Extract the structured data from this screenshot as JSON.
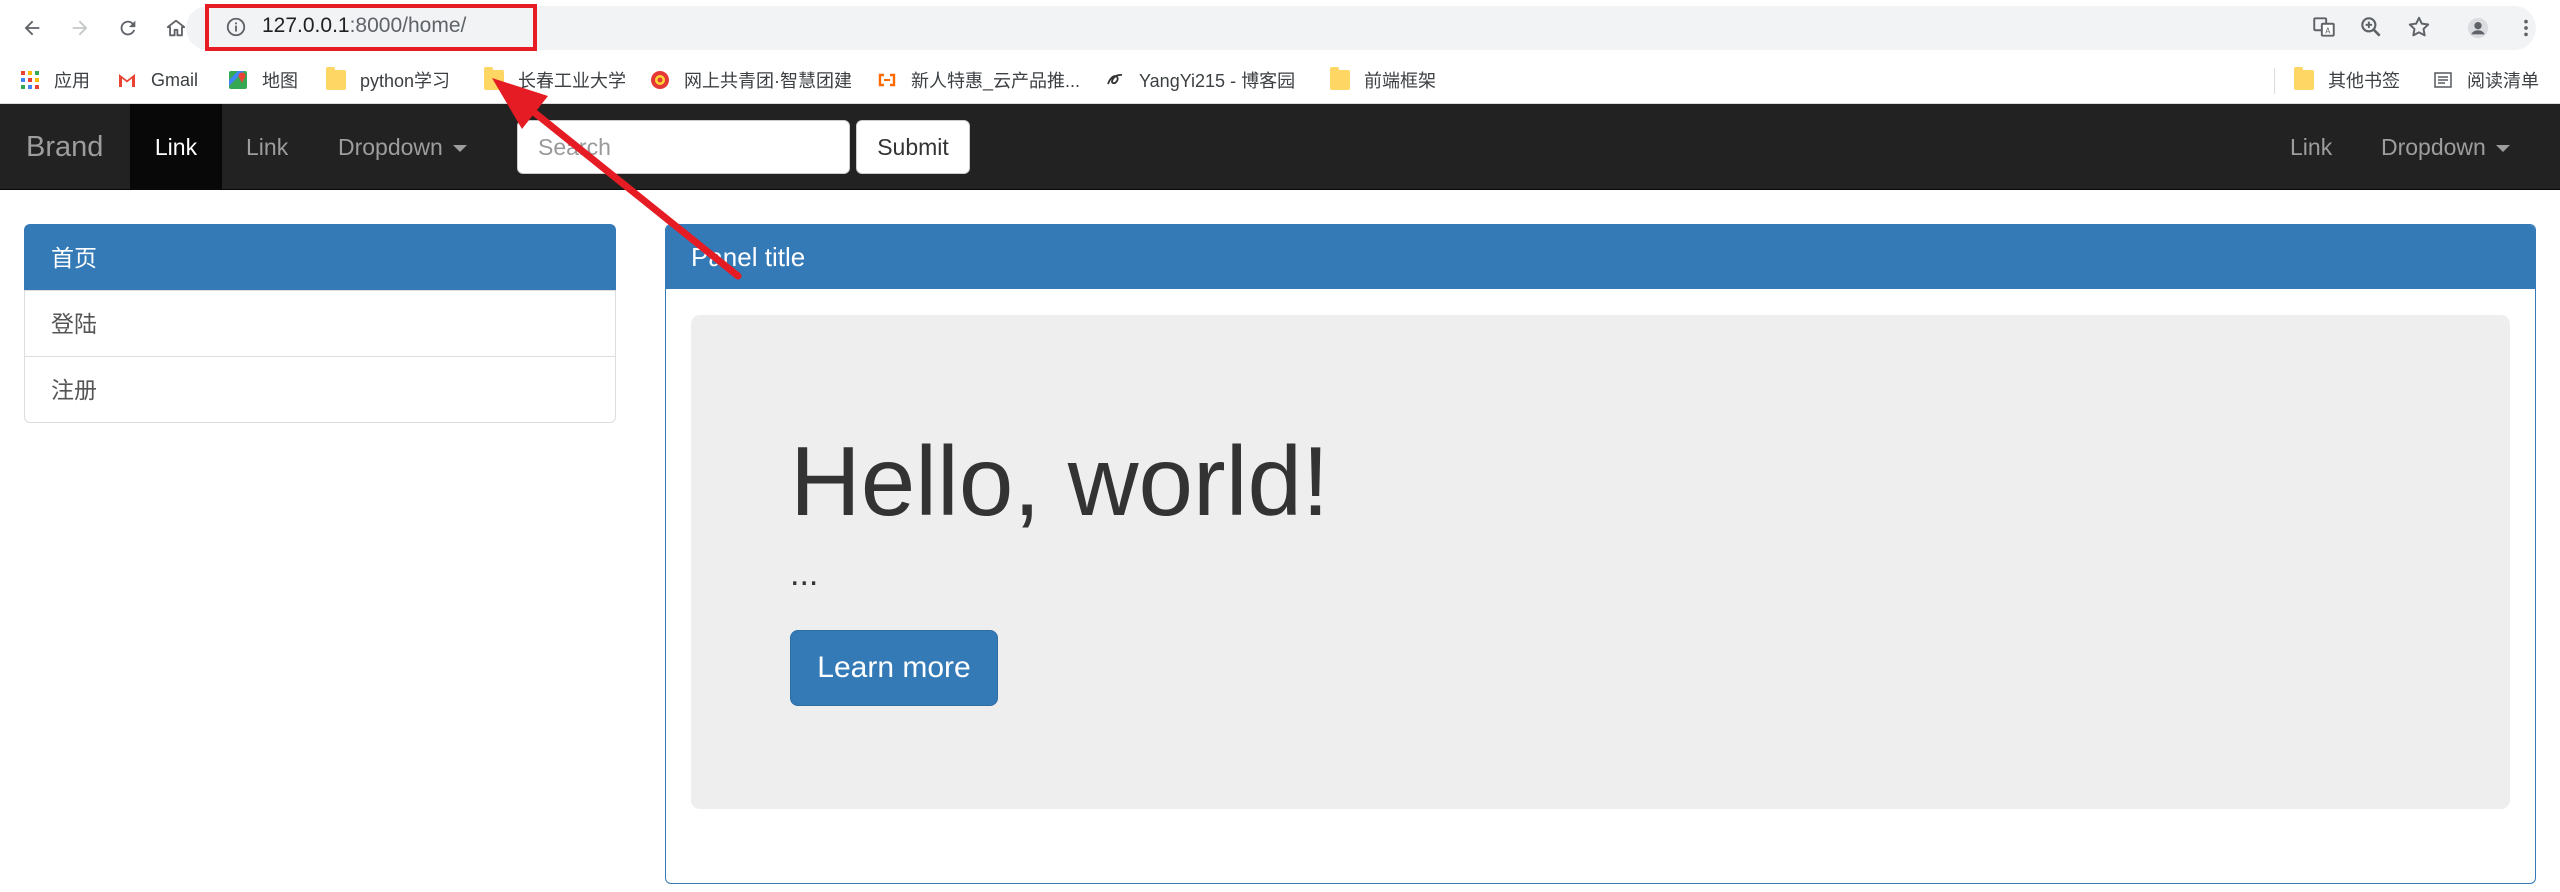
{
  "browser": {
    "url_host": "127.0.0.1",
    "url_rest": ":8000/home/",
    "bookmarks": [
      {
        "label": "应用",
        "icon": "apps-grid-icon"
      },
      {
        "label": "Gmail",
        "icon": "gmail-icon"
      },
      {
        "label": "地图",
        "icon": "maps-icon"
      },
      {
        "label": "python学习",
        "icon": "folder-icon"
      },
      {
        "label": "长春工业大学",
        "icon": "folder-icon"
      },
      {
        "label": "网上共青团·智慧团建",
        "icon": "youth-league-icon"
      },
      {
        "label": "新人特惠_云产品推...",
        "icon": "aliyun-icon"
      },
      {
        "label": "YangYi215 - 博客园",
        "icon": "cnblogs-icon"
      },
      {
        "label": "前端框架",
        "icon": "folder-icon"
      },
      {
        "label": "其他书签",
        "icon": "folder-icon"
      },
      {
        "label": "阅读清单",
        "icon": "reading-list-icon"
      }
    ]
  },
  "navbar": {
    "brand": "Brand",
    "link_active": "Link",
    "link": "Link",
    "dropdown": "Dropdown",
    "search_placeholder": "Search",
    "submit": "Submit",
    "right_link": "Link",
    "right_dropdown": "Dropdown"
  },
  "sidebar": {
    "items": [
      {
        "label": "首页",
        "active": true
      },
      {
        "label": "登陆",
        "active": false
      },
      {
        "label": "注册",
        "active": false
      }
    ]
  },
  "panel": {
    "title": "Panel title",
    "jumbotron": {
      "heading": "Hello, world!",
      "text": "...",
      "button": "Learn more"
    }
  },
  "colors": {
    "primary": "#337ab7",
    "navbar_bg": "#222222",
    "jumbotron_bg": "#eeeeee",
    "annotation_red": "#e51c23"
  }
}
